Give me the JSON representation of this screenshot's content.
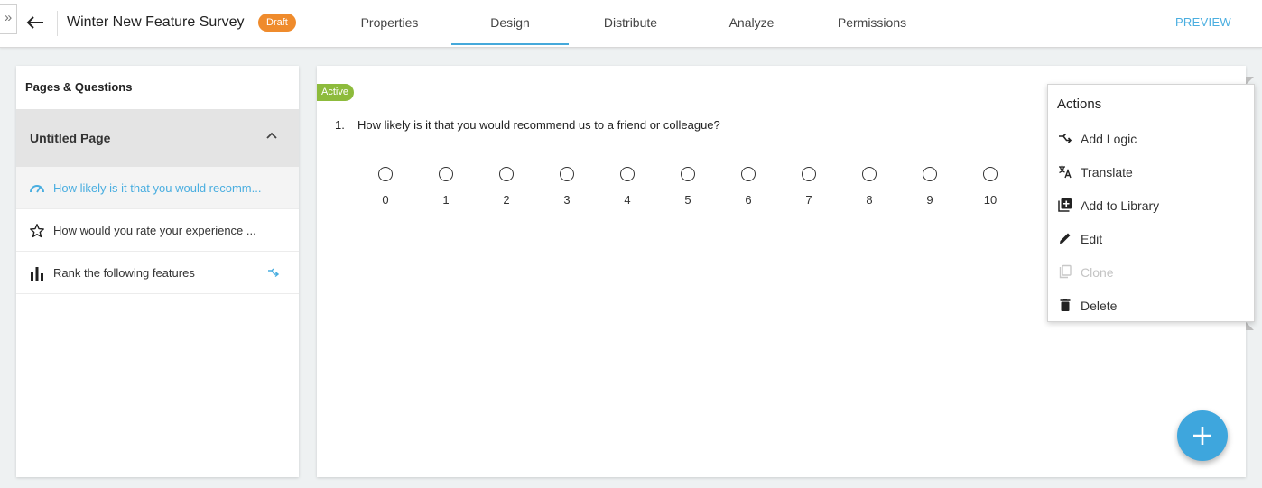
{
  "header": {
    "expand_glyph": "»",
    "title": "Winter New Feature Survey",
    "status_badge": "Draft",
    "preview_label": "PREVIEW",
    "tabs": [
      {
        "label": "Properties"
      },
      {
        "label": "Design"
      },
      {
        "label": "Distribute"
      },
      {
        "label": "Analyze"
      },
      {
        "label": "Permissions"
      }
    ],
    "active_tab": "Design",
    "accent_color": "#45a9db",
    "draft_color": "#ef8b2c"
  },
  "sidebar": {
    "title": "Pages & Questions",
    "page": {
      "label": "Untitled Page"
    },
    "questions": [
      {
        "text": "How likely is it that you would recomm...",
        "icon": "gauge-icon",
        "selected": true
      },
      {
        "text": "How would you rate your experience ...",
        "icon": "star-icon",
        "selected": false
      },
      {
        "text": "Rank the following features",
        "icon": "bar-chart-icon",
        "selected": false,
        "has_logic": true
      }
    ]
  },
  "question": {
    "status_badge": "Active",
    "status_color": "#8dbb3c",
    "number": "1.",
    "text": "How likely is it that you would recommend us to a friend or colleague?",
    "scale": [
      "0",
      "1",
      "2",
      "3",
      "4",
      "5",
      "6",
      "7",
      "8",
      "9",
      "10"
    ]
  },
  "actions_menu": {
    "title": "Actions",
    "items": [
      {
        "label": "Add Logic",
        "icon": "logic-branch-icon",
        "enabled": true
      },
      {
        "label": "Translate",
        "icon": "translate-icon",
        "enabled": true
      },
      {
        "label": "Add to Library",
        "icon": "library-add-icon",
        "enabled": true
      },
      {
        "label": "Edit",
        "icon": "pencil-icon",
        "enabled": true
      },
      {
        "label": "Clone",
        "icon": "copy-icon",
        "enabled": false
      },
      {
        "label": "Delete",
        "icon": "trash-icon",
        "enabled": true
      }
    ]
  },
  "fab": {
    "icon": "plus-icon",
    "color": "#3ea6dd"
  }
}
